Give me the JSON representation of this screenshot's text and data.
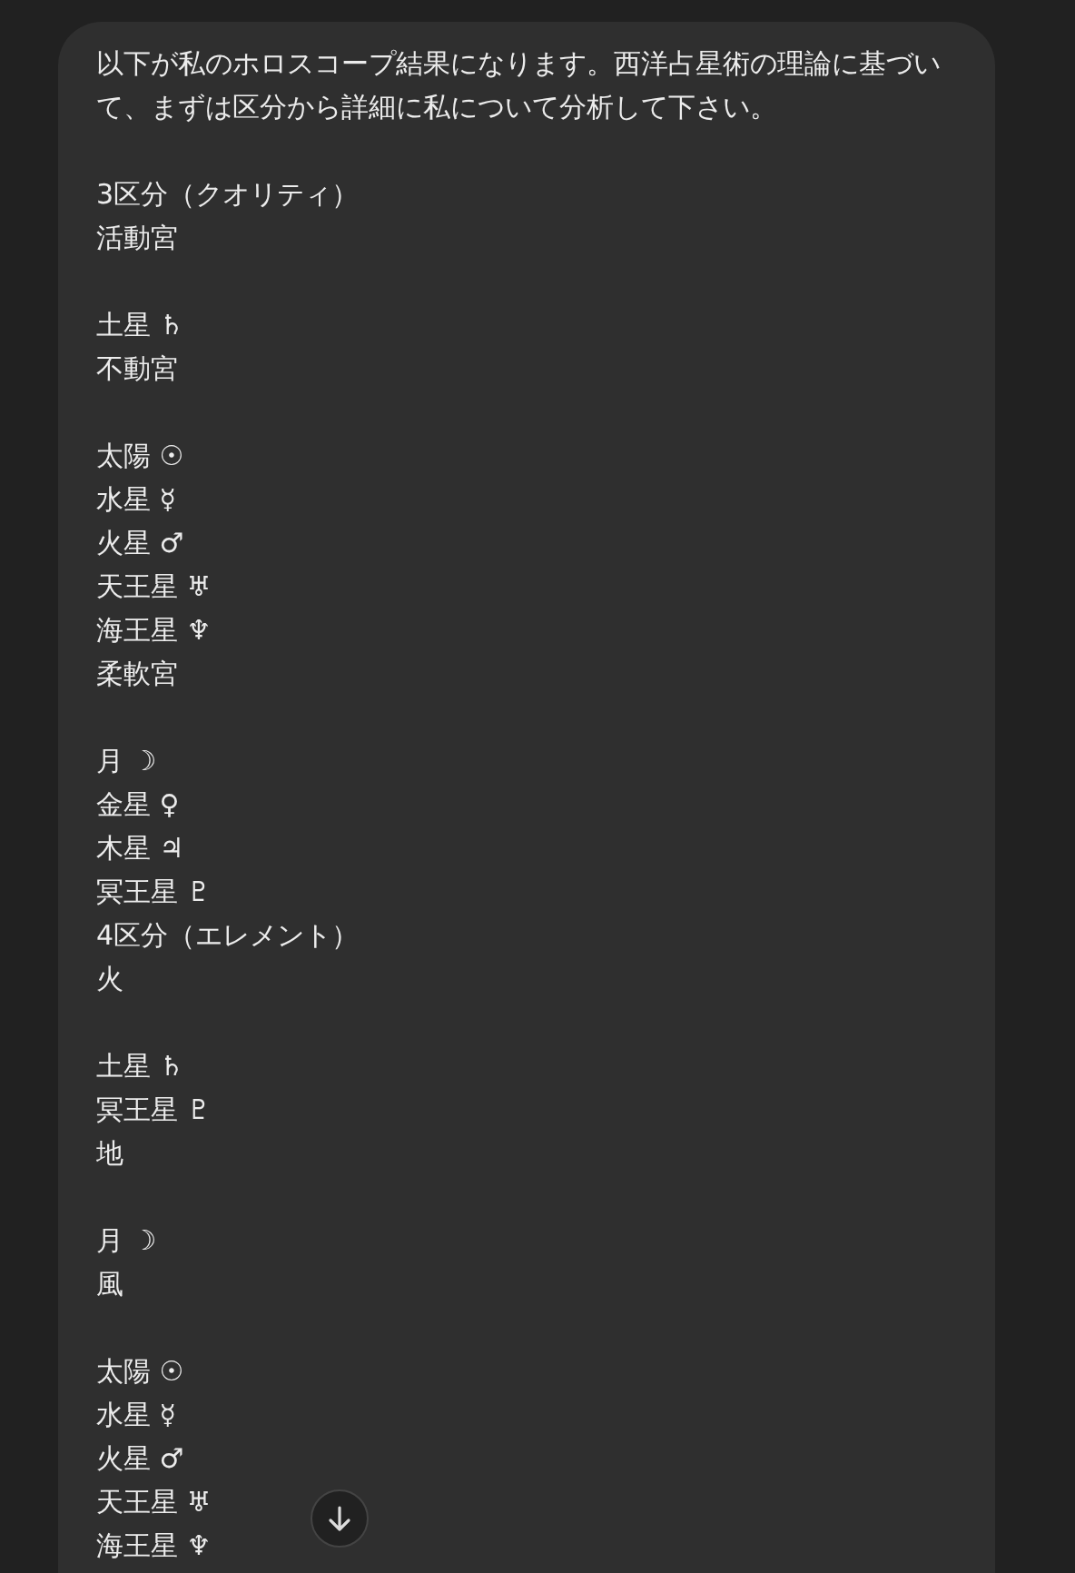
{
  "message": {
    "blocks": [
      {
        "lines": [
          "以下が私のホロスコープ結果になります。西洋占星術の理論に基づいて、まずは区分から詳細に私について分析して下さい。"
        ]
      },
      {
        "lines": [
          "3区分（クオリティ）",
          "活動宮"
        ]
      },
      {
        "lines": [
          "土星 ♄",
          "不動宮"
        ]
      },
      {
        "lines": [
          "太陽 ☉",
          "水星 ☿",
          "火星 ♂",
          "天王星 ♅",
          "海王星 ♆",
          "柔軟宮"
        ]
      },
      {
        "lines": [
          "月 ☽",
          "金星 ♀",
          "木星 ♃",
          "冥王星 ♇",
          "4区分（エレメント）",
          "火"
        ]
      },
      {
        "lines": [
          "土星 ♄",
          "冥王星 ♇",
          "地"
        ]
      },
      {
        "lines": [
          "月 ☽",
          "風"
        ]
      },
      {
        "lines": [
          "太陽 ☉",
          "水星 ☿",
          "火星 ♂",
          "天王星 ♅",
          "海王星 ♆"
        ]
      }
    ]
  }
}
